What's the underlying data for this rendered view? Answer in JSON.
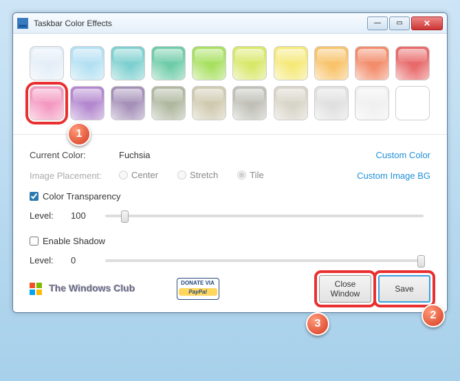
{
  "window": {
    "title": "Taskbar Color Effects"
  },
  "colors": {
    "row1": [
      "#e4eef8",
      "#b3e0f2",
      "#7ed0d0",
      "#6ecca8",
      "#a8e060",
      "#d8e86a",
      "#f5e97a",
      "#f8c36a",
      "#f28c6a",
      "#e86a6a"
    ],
    "row2": [
      "#f49ac1",
      "#b388cf",
      "#a590b8",
      "#b0b8a0",
      "#cfcab0",
      "#c0c0b8",
      "#d8d4c8",
      "#e0e0e0",
      "#f0f0f0",
      "#ffffff"
    ]
  },
  "currentColor": {
    "label": "Current Color:",
    "value": "Fuchsia"
  },
  "customColor": "Custom Color",
  "imagePlacement": {
    "label": "Image Placement:",
    "options": [
      "Center",
      "Stretch",
      "Tile"
    ],
    "selected": "Tile"
  },
  "customImage": "Custom Image BG",
  "transparency": {
    "label": "Color Transparency",
    "checked": true,
    "levelLabel": "Level:",
    "level": "100",
    "pos": 5
  },
  "shadow": {
    "label": "Enable Shadow",
    "checked": false,
    "levelLabel": "Level:",
    "level": "0",
    "pos": 98
  },
  "footer": {
    "brand": "The Windows Club",
    "donate": "DONATE VIA",
    "paypal": "PayPal"
  },
  "buttons": {
    "close": "Close\nWindow",
    "save": "Save"
  },
  "badges": {
    "b1": "1",
    "b2": "2",
    "b3": "3"
  }
}
